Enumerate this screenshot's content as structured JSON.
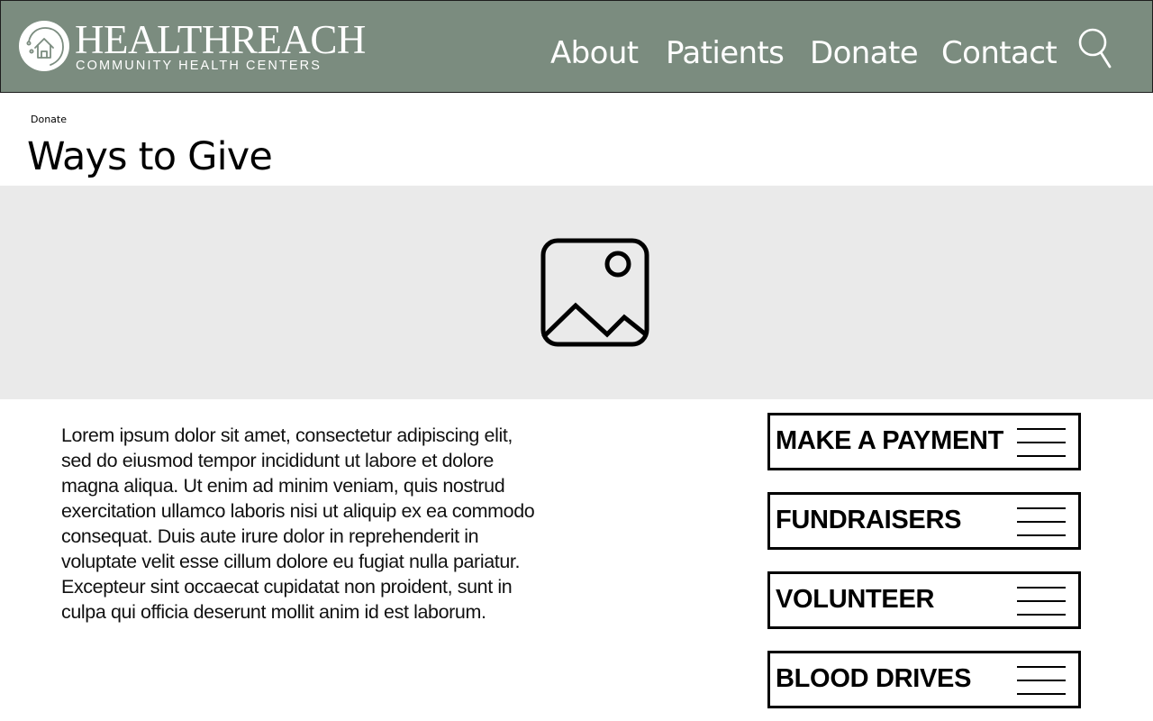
{
  "header": {
    "brand_name": "HEALTHREACH",
    "brand_tagline": "COMMUNITY HEALTH CENTERS",
    "background_color": "#7b8c7f",
    "nav": [
      {
        "label": "About"
      },
      {
        "label": "Patients"
      },
      {
        "label": "Donate"
      },
      {
        "label": "Contact"
      }
    ],
    "search_icon": "search-icon"
  },
  "breadcrumb": "Donate",
  "page_title": "Ways to Give",
  "hero": {
    "icon": "image-placeholder-icon",
    "background_color": "#eaeaea"
  },
  "body_text": "Lorem ipsum dolor sit amet, consectetur adipiscing elit, sed do eiusmod tempor incididunt ut labore et dolore magna aliqua. Ut enim ad minim veniam, quis nostrud exercitation ullamco laboris nisi ut aliquip ex ea commodo consequat. Duis aute irure dolor in reprehenderit in voluptate velit esse cillum dolore eu fugiat nulla pariatur. Excepteur sint occaecat cupidatat non proident, sunt in culpa qui officia deserunt mollit anim id est laborum.",
  "actions": [
    {
      "label": "MAKE A PAYMENT",
      "icon": "menu-icon"
    },
    {
      "label": "FUNDRAISERS",
      "icon": "menu-icon"
    },
    {
      "label": "VOLUNTEER",
      "icon": "menu-icon"
    },
    {
      "label": "BLOOD DRIVES",
      "icon": "menu-icon"
    }
  ]
}
